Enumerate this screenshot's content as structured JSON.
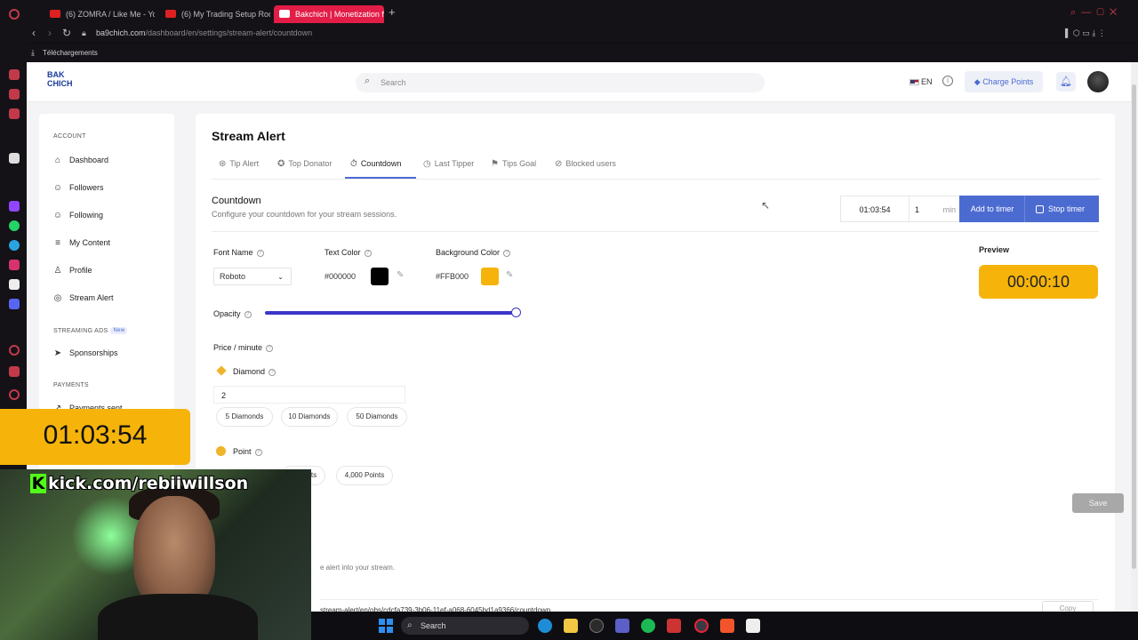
{
  "browser": {
    "tabs": [
      {
        "title": "(6) ZOMRA / Like Me - You"
      },
      {
        "title": "(6) My Trading Setup Roo"
      },
      {
        "title": "Bakchich | Monetization f"
      }
    ],
    "new_tab": "+",
    "url_host": "ba9chich.com",
    "url_path": "/dashboard/en/settings/stream-alert/countdown",
    "bookmark": "Téléchargements"
  },
  "header": {
    "logo": "BAK CHICH",
    "search_placeholder": "Search",
    "language": "EN",
    "charge_points": "Charge Points"
  },
  "sidebar": {
    "account_head": "ACCOUNT",
    "items": [
      {
        "label": "Dashboard"
      },
      {
        "label": "Followers"
      },
      {
        "label": "Following"
      },
      {
        "label": "My Content"
      },
      {
        "label": "Profile"
      },
      {
        "label": "Stream Alert"
      }
    ],
    "streaming_head": "STREAMING ADS",
    "new_badge": "New",
    "sponsorships": "Sponsorships",
    "payments_head": "PAYMENTS",
    "payments_item": "Payments sent"
  },
  "main": {
    "title": "Stream Alert",
    "tabs": [
      {
        "label": "Tip Alert"
      },
      {
        "label": "Top Donator"
      },
      {
        "label": "Countdown"
      },
      {
        "label": "Last Tipper"
      },
      {
        "label": "Tips Goal"
      },
      {
        "label": "Blocked users"
      }
    ],
    "section_title": "Countdown",
    "section_sub": "Configure your countdown for your stream sessions.",
    "timer_value": "01:03:54",
    "minutes_value": "1",
    "minutes_unit": "min",
    "add_to_timer": "Add to timer",
    "stop_timer": "Stop timer",
    "font_name_label": "Font Name",
    "font_value": "Roboto",
    "text_color_label": "Text Color",
    "text_color_hex": "#000000",
    "bg_color_label": "Background Color",
    "bg_color_hex": "#FFB000",
    "opacity_label": "Opacity",
    "opacity": 1.0,
    "price_label": "Price / minute",
    "diamond_label": "Diamond",
    "diamond_value": "2",
    "diamond_chips": [
      "5 Diamonds",
      "10 Diamonds",
      "50 Diamonds"
    ],
    "point_label": "Point",
    "point_chips_visible": [
      "ts",
      "4,000 Points"
    ],
    "preview_label": "Preview",
    "preview_time": "00:00:10",
    "save": "Save",
    "embed_text": "e alert into your stream.",
    "embed_url": "stream-alert/en/obs/cdcfa739-3b06-11ef-a068-6045bd1a9366/countdown",
    "copy": "Copy"
  },
  "overlay": {
    "timer": "01:03:54",
    "kick_handle": "kick.com/rebiiwillson"
  },
  "taskbar": {
    "search": "Search"
  },
  "colors": {
    "accent": "#4c6bd1",
    "timer_bg": "#f6b40b",
    "kick_green": "#53fc18",
    "tab_active": "#e21d47"
  }
}
